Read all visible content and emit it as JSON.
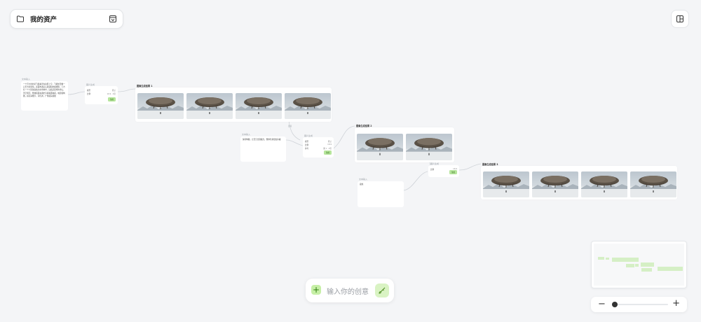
{
  "asset_bar": {
    "title": "我的资产",
    "folder_icon": "folder-icon",
    "collapse_icon": "chevron-box-icon"
  },
  "panel_toggle_icon": "layout-panel-icon",
  "prompt_bar": {
    "placeholder": "输入你的创意",
    "add_label": "+",
    "send_icon": "brush-send-icon"
  },
  "zoom": {
    "level": 0.05,
    "minus": "−",
    "plus": "+"
  },
  "canvas": {
    "text_node_1": {
      "label": "文本输入",
      "text": "一个巨大的外星飞船悬浮在冰原上空，飞船外形像一只巨大的海龟，表面布满岩石质感和金属纹理，下方有一个人影独自站立在雪地中，远处是连绵的雪山，天空阴沉，整体画面充满史诗感和孤独感，电影级构图，超高清细节，冷色调，广角镜头拍摄"
    },
    "param_node_1": {
      "label": "图片生成",
      "rows": [
        {
          "k": "模型",
          "v": "默认"
        },
        {
          "k": "比例",
          "v": "16:9 · 4张"
        }
      ],
      "gen_label": "生成"
    },
    "group_1": {
      "title": "图像生成结果 1"
    },
    "text_node_2": {
      "label": "文本输入",
      "text": "保持构图，让天空出现极光，整体色调更加冷峻"
    },
    "mid_label": "连接",
    "param_node_2": {
      "label": "图片生成",
      "rows": [
        {
          "k": "模型",
          "v": "默认"
        },
        {
          "k": "比例",
          "v": "16:9"
        },
        {
          "k": "参考",
          "v": "图 1 · 2张"
        }
      ],
      "gen_label": "生成"
    },
    "group_2": {
      "title": "图像生成结果 2"
    },
    "text_node_3": {
      "label": "文本输入",
      "text": "夜晚"
    },
    "param_node_3": {
      "label": "图片生成",
      "rows": [
        {
          "k": "比例",
          "v": "16:9"
        }
      ],
      "gen_label": "生成"
    },
    "group_3": {
      "title": "图像生成结果 3"
    }
  }
}
